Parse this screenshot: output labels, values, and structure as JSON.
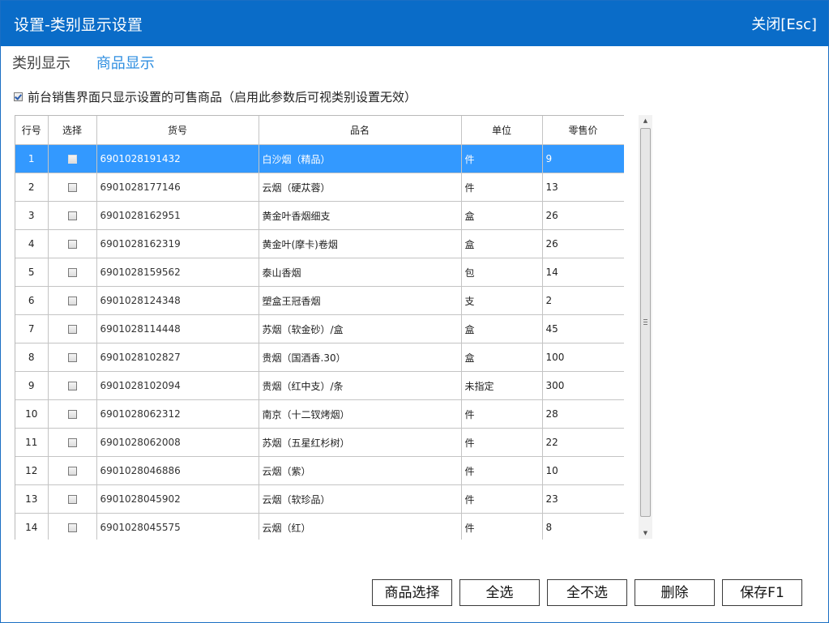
{
  "window": {
    "title": "设置-类别显示设置",
    "close_label": "关闭[Esc]"
  },
  "tabs": [
    {
      "label": "类别显示",
      "active": false
    },
    {
      "label": "商品显示",
      "active": true
    }
  ],
  "option": {
    "checked": true,
    "label": "前台销售界面只显示设置的可售商品（启用此参数后可视类别设置无效）"
  },
  "table": {
    "columns": [
      "行号",
      "选择",
      "货号",
      "品名",
      "单位",
      "零售价"
    ],
    "rows": [
      {
        "no": "1",
        "code": "6901028191432",
        "name": "白沙烟（精品）",
        "unit": "件",
        "price": "9",
        "selected": true
      },
      {
        "no": "2",
        "code": "6901028177146",
        "name": "云烟（硬苁蓉）",
        "unit": "件",
        "price": "13"
      },
      {
        "no": "3",
        "code": "6901028162951",
        "name": "黄金叶香烟细支",
        "unit": "盒",
        "price": "26"
      },
      {
        "no": "4",
        "code": "6901028162319",
        "name": "黄金叶(摩卡)卷烟",
        "unit": "盒",
        "price": "26"
      },
      {
        "no": "5",
        "code": "6901028159562",
        "name": "泰山香烟",
        "unit": "包",
        "price": "14"
      },
      {
        "no": "6",
        "code": "6901028124348",
        "name": "塑盒王冠香烟",
        "unit": "支",
        "price": "2"
      },
      {
        "no": "7",
        "code": "6901028114448",
        "name": "苏烟（软金砂）/盒",
        "unit": "盒",
        "price": "45"
      },
      {
        "no": "8",
        "code": "6901028102827",
        "name": "贵烟（国酒香.30）",
        "unit": "盒",
        "price": "100"
      },
      {
        "no": "9",
        "code": "6901028102094",
        "name": "贵烟（红中支）/条",
        "unit": "未指定",
        "price": "300"
      },
      {
        "no": "10",
        "code": "6901028062312",
        "name": "南京（十二钗烤烟）",
        "unit": "件",
        "price": "28"
      },
      {
        "no": "11",
        "code": "6901028062008",
        "name": "苏烟（五星红杉树）",
        "unit": "件",
        "price": "22"
      },
      {
        "no": "12",
        "code": "6901028046886",
        "name": "云烟（紫）",
        "unit": "件",
        "price": "10"
      },
      {
        "no": "13",
        "code": "6901028045902",
        "name": "云烟（软珍品）",
        "unit": "件",
        "price": "23"
      },
      {
        "no": "14",
        "code": "6901028045575",
        "name": "云烟（红）",
        "unit": "件",
        "price": "8"
      }
    ]
  },
  "buttons": {
    "select_goods": "商品选择",
    "select_all": "全选",
    "select_none": "全不选",
    "delete": "删除",
    "save": "保存F1"
  },
  "colors": {
    "titlebar": "#0a6cc8",
    "active_tab": "#2e8ee0",
    "selected_row": "#3399ff"
  }
}
